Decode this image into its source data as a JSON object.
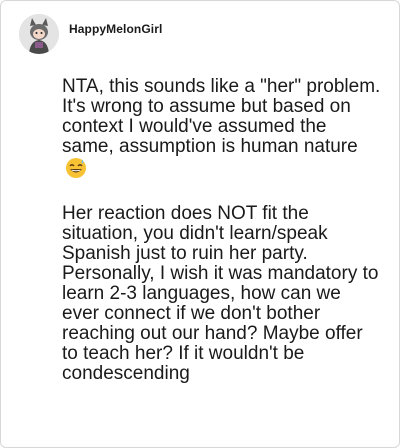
{
  "comment": {
    "username": "HappyMelonGirl",
    "paragraphs": [
      "NTA, this sounds like a \"her\" problem. It's wrong to assume but based on context I would've assumed the same, assumption is human nature",
      "Her reaction does NOT fit the situation, you didn't learn/speak Spanish just to ruin her party. Personally, I wish it was mandatory to learn 2-3 languages, how can we ever connect if we don't bother reaching out our hand? Maybe offer to teach her? If it wouldn't be condescending"
    ],
    "emoji": "grinning-face-with-sweat-icon"
  },
  "colors": {
    "text": "#1a1a1a",
    "border": "#d8d8d8",
    "avatar_bg": "#dcdcdc",
    "emoji_face": "#f7c234"
  }
}
